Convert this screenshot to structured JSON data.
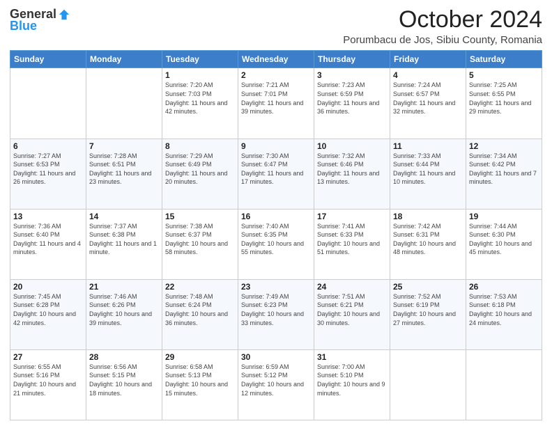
{
  "header": {
    "logo_general": "General",
    "logo_blue": "Blue",
    "month_title": "October 2024",
    "location": "Porumbacu de Jos, Sibiu County, Romania"
  },
  "days_of_week": [
    "Sunday",
    "Monday",
    "Tuesday",
    "Wednesday",
    "Thursday",
    "Friday",
    "Saturday"
  ],
  "weeks": [
    [
      {
        "day": "",
        "info": ""
      },
      {
        "day": "",
        "info": ""
      },
      {
        "day": "1",
        "info": "Sunrise: 7:20 AM\nSunset: 7:03 PM\nDaylight: 11 hours and 42 minutes."
      },
      {
        "day": "2",
        "info": "Sunrise: 7:21 AM\nSunset: 7:01 PM\nDaylight: 11 hours and 39 minutes."
      },
      {
        "day": "3",
        "info": "Sunrise: 7:23 AM\nSunset: 6:59 PM\nDaylight: 11 hours and 36 minutes."
      },
      {
        "day": "4",
        "info": "Sunrise: 7:24 AM\nSunset: 6:57 PM\nDaylight: 11 hours and 32 minutes."
      },
      {
        "day": "5",
        "info": "Sunrise: 7:25 AM\nSunset: 6:55 PM\nDaylight: 11 hours and 29 minutes."
      }
    ],
    [
      {
        "day": "6",
        "info": "Sunrise: 7:27 AM\nSunset: 6:53 PM\nDaylight: 11 hours and 26 minutes."
      },
      {
        "day": "7",
        "info": "Sunrise: 7:28 AM\nSunset: 6:51 PM\nDaylight: 11 hours and 23 minutes."
      },
      {
        "day": "8",
        "info": "Sunrise: 7:29 AM\nSunset: 6:49 PM\nDaylight: 11 hours and 20 minutes."
      },
      {
        "day": "9",
        "info": "Sunrise: 7:30 AM\nSunset: 6:47 PM\nDaylight: 11 hours and 17 minutes."
      },
      {
        "day": "10",
        "info": "Sunrise: 7:32 AM\nSunset: 6:46 PM\nDaylight: 11 hours and 13 minutes."
      },
      {
        "day": "11",
        "info": "Sunrise: 7:33 AM\nSunset: 6:44 PM\nDaylight: 11 hours and 10 minutes."
      },
      {
        "day": "12",
        "info": "Sunrise: 7:34 AM\nSunset: 6:42 PM\nDaylight: 11 hours and 7 minutes."
      }
    ],
    [
      {
        "day": "13",
        "info": "Sunrise: 7:36 AM\nSunset: 6:40 PM\nDaylight: 11 hours and 4 minutes."
      },
      {
        "day": "14",
        "info": "Sunrise: 7:37 AM\nSunset: 6:38 PM\nDaylight: 11 hours and 1 minute."
      },
      {
        "day": "15",
        "info": "Sunrise: 7:38 AM\nSunset: 6:37 PM\nDaylight: 10 hours and 58 minutes."
      },
      {
        "day": "16",
        "info": "Sunrise: 7:40 AM\nSunset: 6:35 PM\nDaylight: 10 hours and 55 minutes."
      },
      {
        "day": "17",
        "info": "Sunrise: 7:41 AM\nSunset: 6:33 PM\nDaylight: 10 hours and 51 minutes."
      },
      {
        "day": "18",
        "info": "Sunrise: 7:42 AM\nSunset: 6:31 PM\nDaylight: 10 hours and 48 minutes."
      },
      {
        "day": "19",
        "info": "Sunrise: 7:44 AM\nSunset: 6:30 PM\nDaylight: 10 hours and 45 minutes."
      }
    ],
    [
      {
        "day": "20",
        "info": "Sunrise: 7:45 AM\nSunset: 6:28 PM\nDaylight: 10 hours and 42 minutes."
      },
      {
        "day": "21",
        "info": "Sunrise: 7:46 AM\nSunset: 6:26 PM\nDaylight: 10 hours and 39 minutes."
      },
      {
        "day": "22",
        "info": "Sunrise: 7:48 AM\nSunset: 6:24 PM\nDaylight: 10 hours and 36 minutes."
      },
      {
        "day": "23",
        "info": "Sunrise: 7:49 AM\nSunset: 6:23 PM\nDaylight: 10 hours and 33 minutes."
      },
      {
        "day": "24",
        "info": "Sunrise: 7:51 AM\nSunset: 6:21 PM\nDaylight: 10 hours and 30 minutes."
      },
      {
        "day": "25",
        "info": "Sunrise: 7:52 AM\nSunset: 6:19 PM\nDaylight: 10 hours and 27 minutes."
      },
      {
        "day": "26",
        "info": "Sunrise: 7:53 AM\nSunset: 6:18 PM\nDaylight: 10 hours and 24 minutes."
      }
    ],
    [
      {
        "day": "27",
        "info": "Sunrise: 6:55 AM\nSunset: 5:16 PM\nDaylight: 10 hours and 21 minutes."
      },
      {
        "day": "28",
        "info": "Sunrise: 6:56 AM\nSunset: 5:15 PM\nDaylight: 10 hours and 18 minutes."
      },
      {
        "day": "29",
        "info": "Sunrise: 6:58 AM\nSunset: 5:13 PM\nDaylight: 10 hours and 15 minutes."
      },
      {
        "day": "30",
        "info": "Sunrise: 6:59 AM\nSunset: 5:12 PM\nDaylight: 10 hours and 12 minutes."
      },
      {
        "day": "31",
        "info": "Sunrise: 7:00 AM\nSunset: 5:10 PM\nDaylight: 10 hours and 9 minutes."
      },
      {
        "day": "",
        "info": ""
      },
      {
        "day": "",
        "info": ""
      }
    ]
  ]
}
